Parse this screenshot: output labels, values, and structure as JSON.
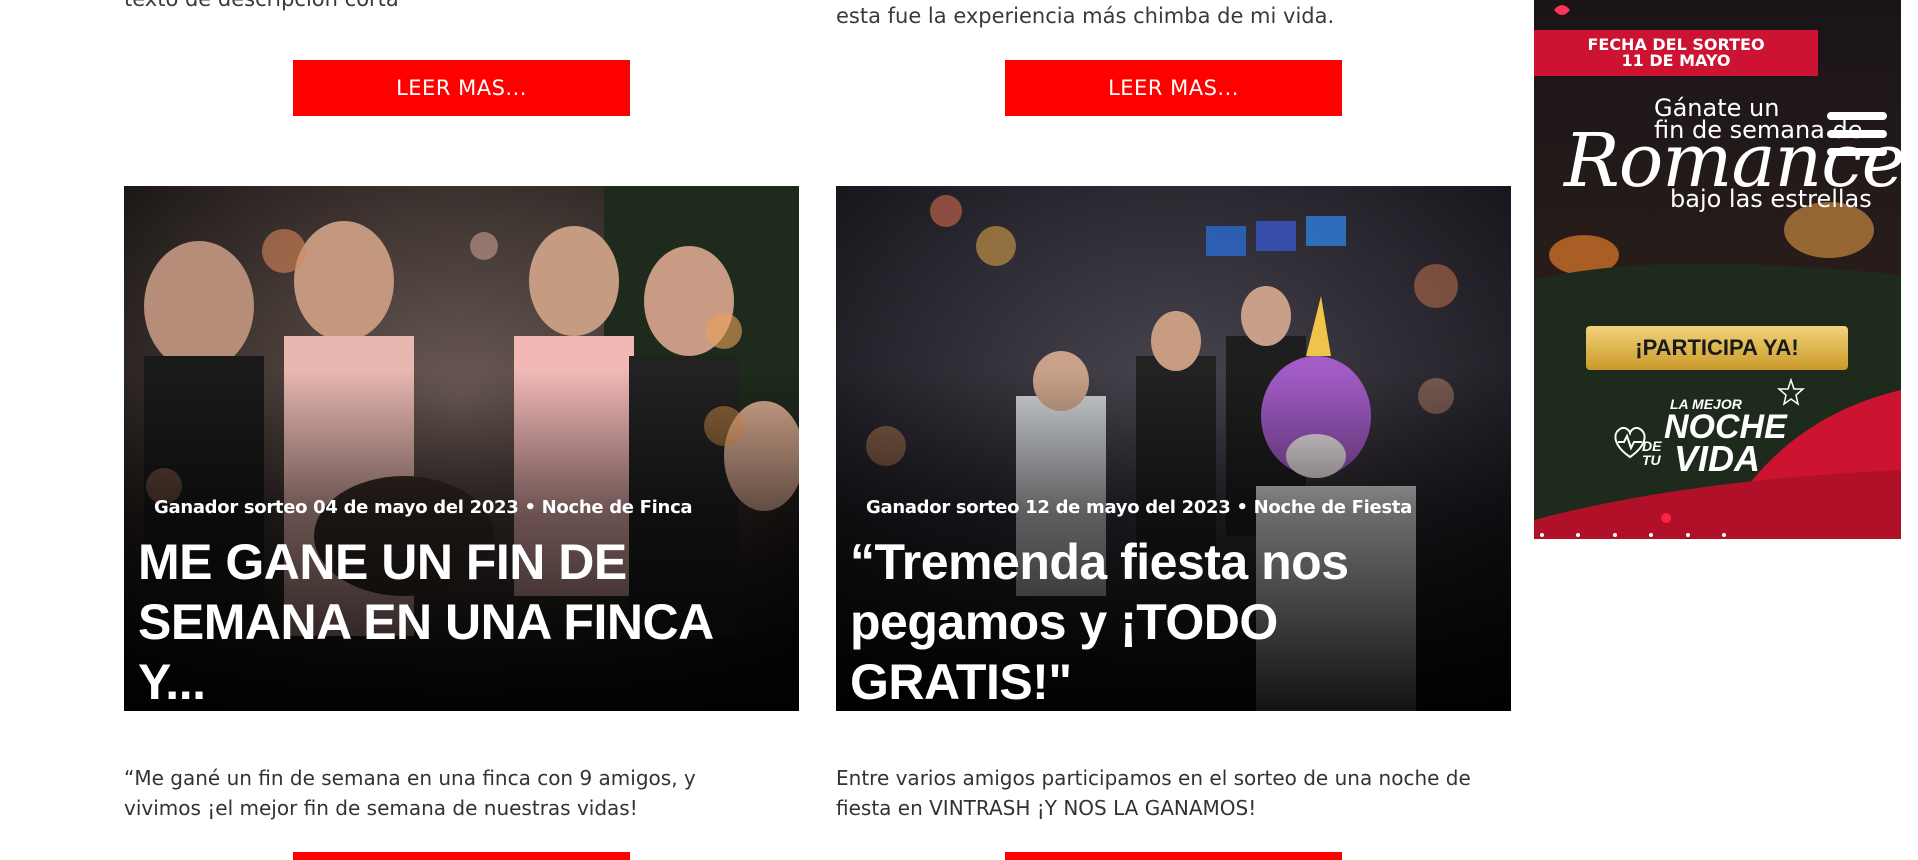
{
  "posts": [
    {
      "excerpt_top": "texto de descripción corta",
      "read_more": "LEER MAS...",
      "meta": "Ganador sorteo 04 de mayo del 2023 • Noche de Finca",
      "title": "ME GANE UN FIN DE SEMANA EN UNA FINCA Y...",
      "excerpt": "“Me gané un fin de semana en una finca con 9 amigos, y vivimos ¡el mejor fin de semana de nuestras vidas!"
    },
    {
      "excerpt_top": "esta fue la experiencia más chimba de mi vida.",
      "read_more": "LEER MAS...",
      "meta": "Ganador sorteo 12 de mayo del 2023 • Noche de Fiesta",
      "title": "“Tremenda fiesta nos pegamos y ¡TODO GRATIS!\"",
      "excerpt": "Entre varios amigos participamos en el sorteo de una noche de fiesta en VINTRASH ¡Y NOS LA GANAMOS!"
    }
  ],
  "promo": {
    "label_line1": "FECHA DEL SORTEO",
    "label_line2": "11 DE MAYO",
    "line1": "Gánate un",
    "line2": "fin de semana de",
    "script": "Romance",
    "line3": "bajo las estrellas",
    "cta": "¡PARTICIPA YA!",
    "tag_small1": "LA MEJOR",
    "tag_big1": "NOCHE",
    "tag_small2": "DE",
    "tag_small3": "TU",
    "tag_big2": "VIDA"
  },
  "colors": {
    "accent": "#ff0000",
    "promo_red": "#cc1332"
  },
  "icons": {
    "menu": "hamburger-menu-icon"
  }
}
